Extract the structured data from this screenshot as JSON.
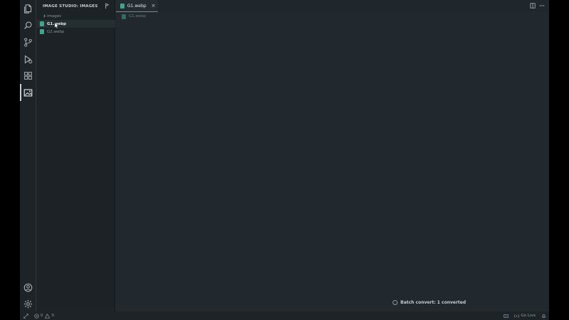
{
  "sidebar": {
    "title": "IMAGE STUDIO: IMAGES",
    "items": [
      {
        "label": "images",
        "type": "folder"
      },
      {
        "label": "G1.webp",
        "type": "file",
        "selected": true
      },
      {
        "label": "G2.webp",
        "type": "file",
        "selected": false
      }
    ]
  },
  "tabs": [
    {
      "label": "G1.webp",
      "close": "×"
    }
  ],
  "breadcrumb": {
    "label": "G1.webp"
  },
  "notification": {
    "text": "Batch convert: 1 converted"
  },
  "statusbar": {
    "errors": "0",
    "warnings": "0",
    "golive": "Go Live"
  },
  "icons": {
    "activity": [
      "files-icon",
      "search-icon",
      "source-control-icon",
      "run-debug-icon",
      "extensions-icon",
      "image-icon"
    ],
    "bottom": [
      "account-icon",
      "settings-gear-icon"
    ]
  },
  "colors": {
    "accent": "#3fa58f",
    "background": "#20272c"
  }
}
